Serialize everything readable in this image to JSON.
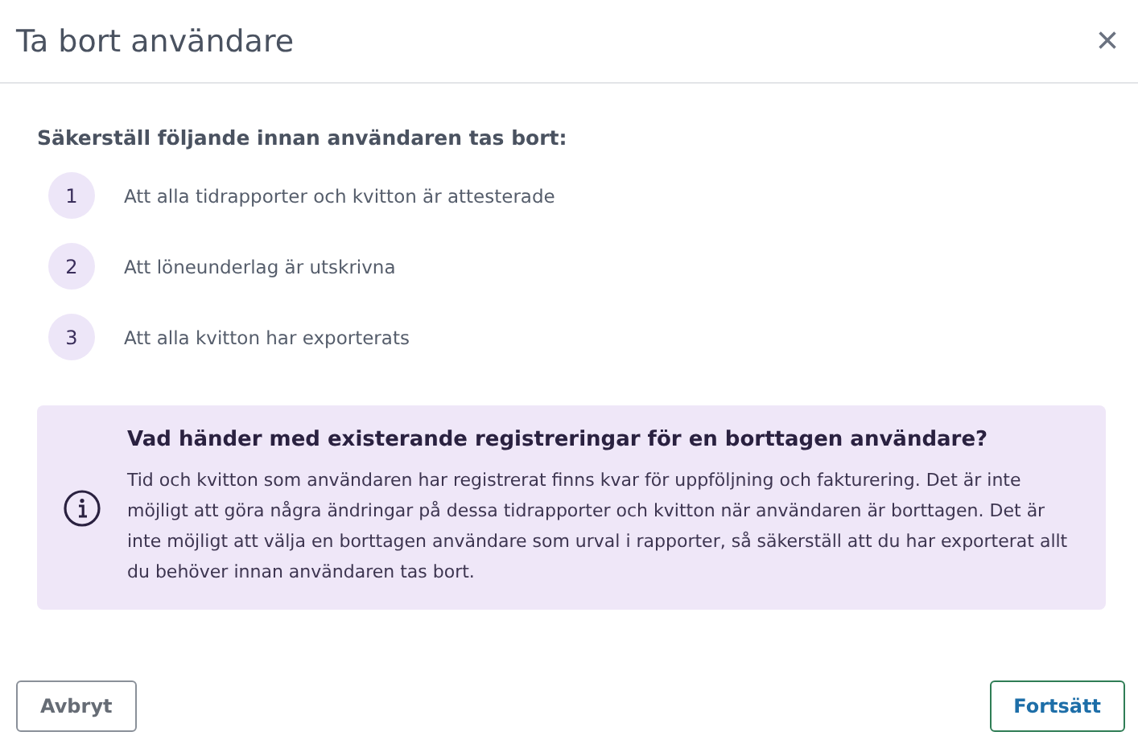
{
  "dialog": {
    "title": "Ta bort användare",
    "close": "×"
  },
  "intro": "Säkerställ följande innan användaren tas bort:",
  "steps": [
    {
      "number": "1",
      "text": "Att alla tidrapporter och kvitton är attesterade"
    },
    {
      "number": "2",
      "text": "Att löneunderlag är utskrivna"
    },
    {
      "number": "3",
      "text": "Att alla kvitton har exporterats"
    }
  ],
  "info": {
    "title": "Vad händer med existerande registreringar för en borttagen användare?",
    "body": "Tid och kvitton som användaren har registrerat finns kvar för uppföljning och fakturering. Det är inte möjligt att göra några ändringar på dessa tidrapporter och kvitton när användaren är borttagen. Det är inte möjligt att välja en borttagen användare som urval i rapporter, så säkerställ att du har exporterat allt du behöver innan användaren tas bort."
  },
  "buttons": [
    {
      "label": "Avbryt",
      "kind": "secondary"
    },
    {
      "label": "Fortsätt",
      "kind": "primary"
    }
  ]
}
